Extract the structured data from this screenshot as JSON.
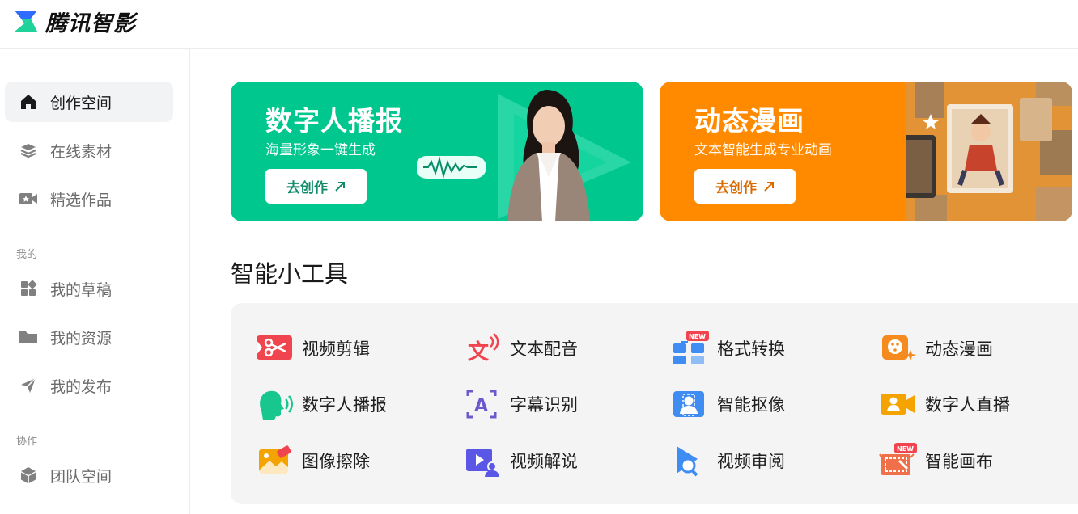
{
  "header": {
    "logo_text": "腾讯智影"
  },
  "sidebar": {
    "items": [
      {
        "label": "创作空间",
        "icon": "home-icon",
        "active": true
      },
      {
        "label": "在线素材",
        "icon": "layers-icon",
        "active": false
      },
      {
        "label": "精选作品",
        "icon": "video-star-icon",
        "active": false
      }
    ],
    "section_mine": "我的",
    "mine_items": [
      {
        "label": "我的草稿",
        "icon": "grid-icon"
      },
      {
        "label": "我的资源",
        "icon": "folder-icon"
      },
      {
        "label": "我的发布",
        "icon": "send-icon"
      }
    ],
    "section_collab": "协作",
    "collab_items": [
      {
        "label": "团队空间",
        "icon": "cube-icon"
      }
    ]
  },
  "banners": [
    {
      "title": "数字人播报",
      "subtitle": "海量形象一键生成",
      "button": "去创作",
      "color": "#00c78e"
    },
    {
      "title": "动态漫画",
      "subtitle": "文本智能生成专业动画",
      "button": "去创作",
      "color": "#ff8a00"
    }
  ],
  "tools": {
    "title": "智能小工具",
    "items": [
      {
        "label": "视频剪辑",
        "icon": "scissors-icon"
      },
      {
        "label": "文本配音",
        "icon": "text-voice-icon"
      },
      {
        "label": "格式转换",
        "icon": "convert-icon",
        "badge": "NEW"
      },
      {
        "label": "动态漫画",
        "icon": "palette-icon"
      },
      {
        "label": "数字人播报",
        "icon": "speaking-head-icon"
      },
      {
        "label": "字幕识别",
        "icon": "subtitle-icon"
      },
      {
        "label": "智能抠像",
        "icon": "portrait-cutout-icon"
      },
      {
        "label": "数字人直播",
        "icon": "live-camera-icon"
      },
      {
        "label": "图像擦除",
        "icon": "image-erase-icon"
      },
      {
        "label": "视频解说",
        "icon": "video-narration-icon"
      },
      {
        "label": "视频审阅",
        "icon": "video-review-icon"
      },
      {
        "label": "智能画布",
        "icon": "canvas-icon",
        "badge": "NEW"
      }
    ]
  }
}
